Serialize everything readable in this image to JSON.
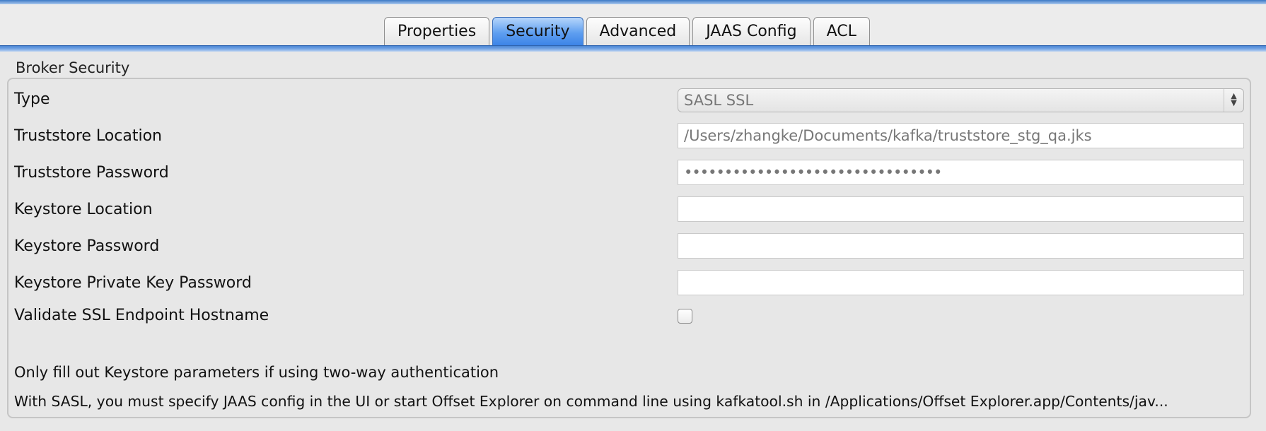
{
  "tabs": [
    {
      "label": "Properties",
      "active": false
    },
    {
      "label": "Security",
      "active": true
    },
    {
      "label": "Advanced",
      "active": false
    },
    {
      "label": "JAAS Config",
      "active": false
    },
    {
      "label": "ACL",
      "active": false
    }
  ],
  "group": {
    "title": "Broker Security"
  },
  "fields": {
    "type": {
      "label": "Type",
      "value": "SASL SSL"
    },
    "truststore_location": {
      "label": "Truststore Location",
      "value": "/Users/zhangke/Documents/kafka/truststore_stg_qa.jks"
    },
    "truststore_password": {
      "label": "Truststore Password",
      "value": "••••••••••••••••••••••••••••••••"
    },
    "keystore_location": {
      "label": "Keystore Location",
      "value": ""
    },
    "keystore_password": {
      "label": "Keystore Password",
      "value": ""
    },
    "keystore_private_key_password": {
      "label": "Keystore Private Key Password",
      "value": ""
    },
    "validate_hostname": {
      "label": "Validate SSL Endpoint Hostname",
      "checked": false
    }
  },
  "notes": {
    "keystore_note": "Only fill out Keystore parameters if using two-way authentication",
    "sasl_note": "With SASL, you must specify JAAS config in the UI or start Offset Explorer on command line using kafkatool.sh in /Applications/Offset Explorer.app/Contents/jav..."
  },
  "colors": {
    "active_tab": "#5f9ff0",
    "tab_rule": "#4a86d3"
  },
  "icons": {
    "select_arrows": "up-down-chevron-icon"
  }
}
